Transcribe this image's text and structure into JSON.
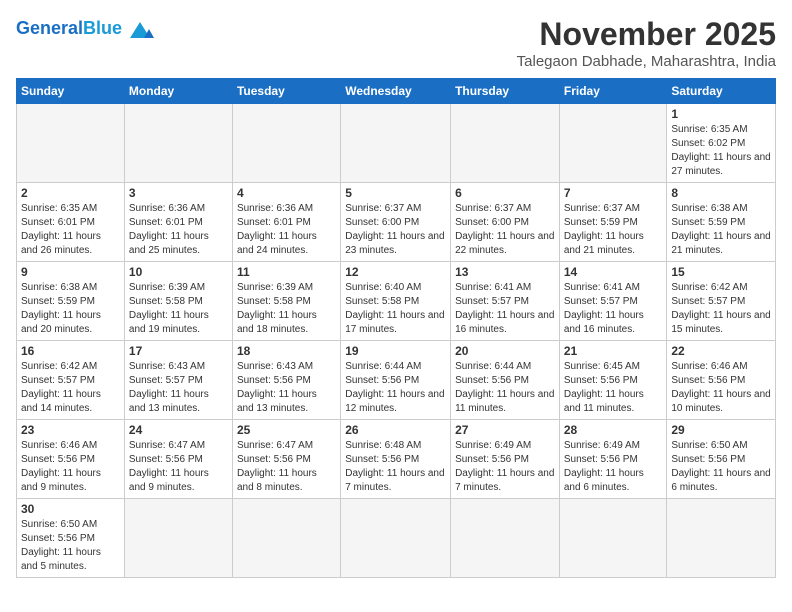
{
  "header": {
    "logo_general": "General",
    "logo_blue": "Blue",
    "month": "November 2025",
    "location": "Talegaon Dabhade, Maharashtra, India"
  },
  "days_of_week": [
    "Sunday",
    "Monday",
    "Tuesday",
    "Wednesday",
    "Thursday",
    "Friday",
    "Saturday"
  ],
  "weeks": [
    [
      {
        "day": "",
        "empty": true
      },
      {
        "day": "",
        "empty": true
      },
      {
        "day": "",
        "empty": true
      },
      {
        "day": "",
        "empty": true
      },
      {
        "day": "",
        "empty": true
      },
      {
        "day": "",
        "empty": true
      },
      {
        "day": "1",
        "sunrise": "6:35 AM",
        "sunset": "6:02 PM",
        "daylight": "11 hours and 27 minutes."
      }
    ],
    [
      {
        "day": "2",
        "sunrise": "6:35 AM",
        "sunset": "6:01 PM",
        "daylight": "11 hours and 26 minutes."
      },
      {
        "day": "3",
        "sunrise": "6:36 AM",
        "sunset": "6:01 PM",
        "daylight": "11 hours and 25 minutes."
      },
      {
        "day": "4",
        "sunrise": "6:36 AM",
        "sunset": "6:01 PM",
        "daylight": "11 hours and 24 minutes."
      },
      {
        "day": "5",
        "sunrise": "6:37 AM",
        "sunset": "6:00 PM",
        "daylight": "11 hours and 23 minutes."
      },
      {
        "day": "6",
        "sunrise": "6:37 AM",
        "sunset": "6:00 PM",
        "daylight": "11 hours and 22 minutes."
      },
      {
        "day": "7",
        "sunrise": "6:37 AM",
        "sunset": "5:59 PM",
        "daylight": "11 hours and 21 minutes."
      },
      {
        "day": "8",
        "sunrise": "6:38 AM",
        "sunset": "5:59 PM",
        "daylight": "11 hours and 21 minutes."
      }
    ],
    [
      {
        "day": "9",
        "sunrise": "6:38 AM",
        "sunset": "5:59 PM",
        "daylight": "11 hours and 20 minutes."
      },
      {
        "day": "10",
        "sunrise": "6:39 AM",
        "sunset": "5:58 PM",
        "daylight": "11 hours and 19 minutes."
      },
      {
        "day": "11",
        "sunrise": "6:39 AM",
        "sunset": "5:58 PM",
        "daylight": "11 hours and 18 minutes."
      },
      {
        "day": "12",
        "sunrise": "6:40 AM",
        "sunset": "5:58 PM",
        "daylight": "11 hours and 17 minutes."
      },
      {
        "day": "13",
        "sunrise": "6:41 AM",
        "sunset": "5:57 PM",
        "daylight": "11 hours and 16 minutes."
      },
      {
        "day": "14",
        "sunrise": "6:41 AM",
        "sunset": "5:57 PM",
        "daylight": "11 hours and 16 minutes."
      },
      {
        "day": "15",
        "sunrise": "6:42 AM",
        "sunset": "5:57 PM",
        "daylight": "11 hours and 15 minutes."
      }
    ],
    [
      {
        "day": "16",
        "sunrise": "6:42 AM",
        "sunset": "5:57 PM",
        "daylight": "11 hours and 14 minutes."
      },
      {
        "day": "17",
        "sunrise": "6:43 AM",
        "sunset": "5:57 PM",
        "daylight": "11 hours and 13 minutes."
      },
      {
        "day": "18",
        "sunrise": "6:43 AM",
        "sunset": "5:56 PM",
        "daylight": "11 hours and 13 minutes."
      },
      {
        "day": "19",
        "sunrise": "6:44 AM",
        "sunset": "5:56 PM",
        "daylight": "11 hours and 12 minutes."
      },
      {
        "day": "20",
        "sunrise": "6:44 AM",
        "sunset": "5:56 PM",
        "daylight": "11 hours and 11 minutes."
      },
      {
        "day": "21",
        "sunrise": "6:45 AM",
        "sunset": "5:56 PM",
        "daylight": "11 hours and 11 minutes."
      },
      {
        "day": "22",
        "sunrise": "6:46 AM",
        "sunset": "5:56 PM",
        "daylight": "11 hours and 10 minutes."
      }
    ],
    [
      {
        "day": "23",
        "sunrise": "6:46 AM",
        "sunset": "5:56 PM",
        "daylight": "11 hours and 9 minutes."
      },
      {
        "day": "24",
        "sunrise": "6:47 AM",
        "sunset": "5:56 PM",
        "daylight": "11 hours and 9 minutes."
      },
      {
        "day": "25",
        "sunrise": "6:47 AM",
        "sunset": "5:56 PM",
        "daylight": "11 hours and 8 minutes."
      },
      {
        "day": "26",
        "sunrise": "6:48 AM",
        "sunset": "5:56 PM",
        "daylight": "11 hours and 7 minutes."
      },
      {
        "day": "27",
        "sunrise": "6:49 AM",
        "sunset": "5:56 PM",
        "daylight": "11 hours and 7 minutes."
      },
      {
        "day": "28",
        "sunrise": "6:49 AM",
        "sunset": "5:56 PM",
        "daylight": "11 hours and 6 minutes."
      },
      {
        "day": "29",
        "sunrise": "6:50 AM",
        "sunset": "5:56 PM",
        "daylight": "11 hours and 6 minutes."
      }
    ],
    [
      {
        "day": "30",
        "sunrise": "6:50 AM",
        "sunset": "5:56 PM",
        "daylight": "11 hours and 5 minutes."
      },
      {
        "day": "",
        "empty": true
      },
      {
        "day": "",
        "empty": true
      },
      {
        "day": "",
        "empty": true
      },
      {
        "day": "",
        "empty": true
      },
      {
        "day": "",
        "empty": true
      },
      {
        "day": "",
        "empty": true
      }
    ]
  ]
}
